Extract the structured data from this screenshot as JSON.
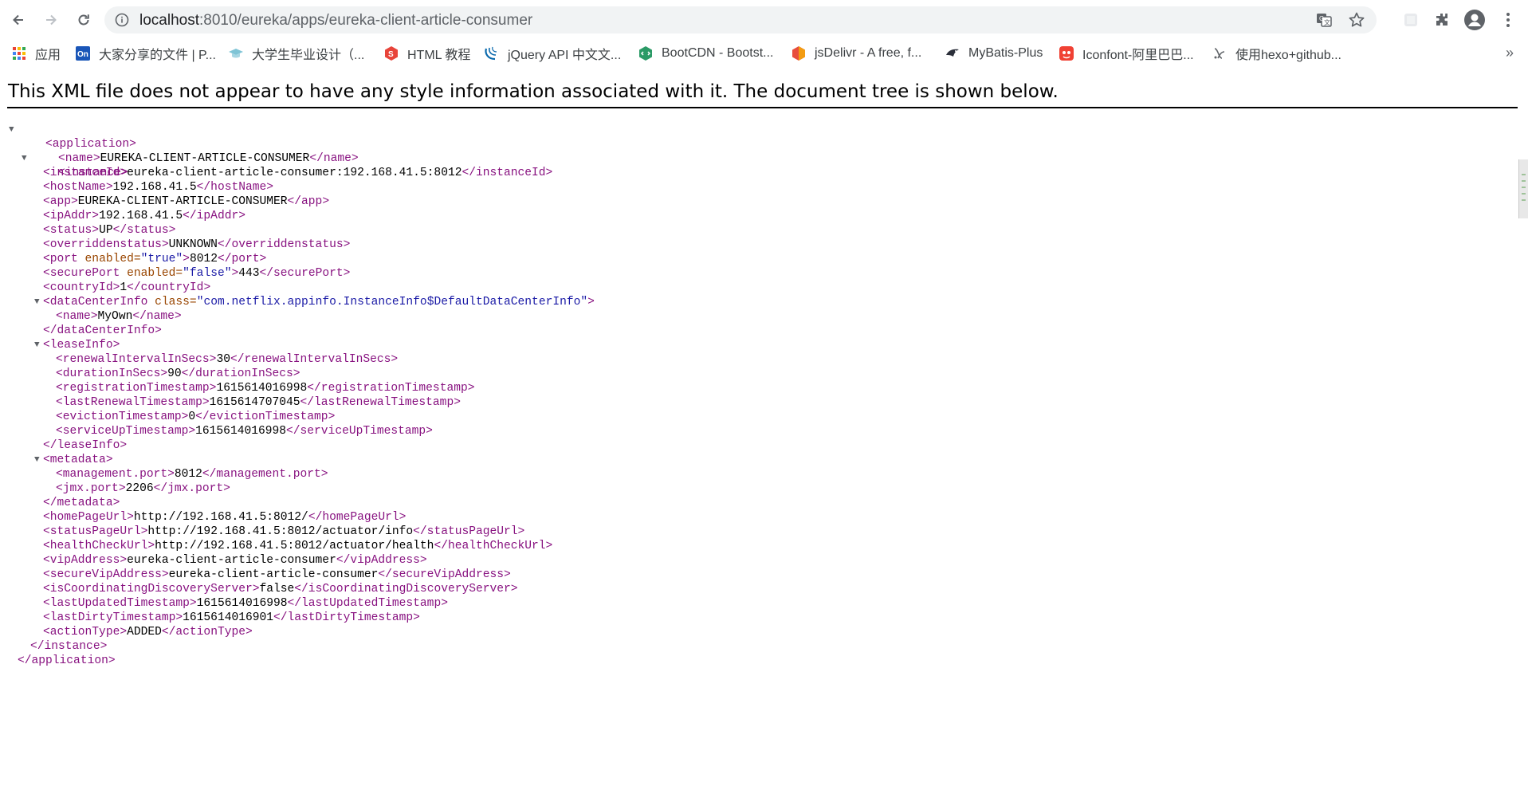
{
  "browser": {
    "url_host": "localhost",
    "url_rest": ":8010/eureka/apps/eureka-client-article-consumer"
  },
  "bookmarks": [
    {
      "label": "应用",
      "icon": "apps-grid-icon"
    },
    {
      "label": "大家分享的文件 | P...",
      "icon": "on-logo-icon"
    },
    {
      "label": "大学生毕业设计（...",
      "icon": "mortarboard-icon"
    },
    {
      "label": "HTML 教程",
      "icon": "runoob-icon"
    },
    {
      "label": "jQuery API 中文文...",
      "icon": "jquery-icon"
    },
    {
      "label": "BootCDN - Bootst...",
      "icon": "bootcdn-icon"
    },
    {
      "label": "jsDelivr - A free, f...",
      "icon": "jsdelivr-icon"
    },
    {
      "label": "MyBatis-Plus",
      "icon": "mybatis-plus-icon"
    },
    {
      "label": "Iconfont-阿里巴巴...",
      "icon": "iconfont-icon"
    },
    {
      "label": "使用hexo+github...",
      "icon": "hexo-icon"
    }
  ],
  "bookmarks_more": "»",
  "notice": "This XML file does not appear to have any style information associated with it. The document tree is shown below.",
  "colors": {
    "tag": "#881280",
    "attribute_name": "#994500",
    "attribute_value": "#1a1aa6",
    "text": "#000000"
  },
  "xml": {
    "application_open": "<application>",
    "name": {
      "open": "<name>",
      "value": "EUREKA-CLIENT-ARTICLE-CONSUMER",
      "close": "</name>"
    },
    "instance_open": "<instance>",
    "fields": [
      {
        "open": "<instanceId>",
        "value": "eureka-client-article-consumer:192.168.41.5:8012",
        "close": "</instanceId>"
      },
      {
        "open": "<hostName>",
        "value": "192.168.41.5",
        "close": "</hostName>"
      },
      {
        "open": "<app>",
        "value": "EUREKA-CLIENT-ARTICLE-CONSUMER",
        "close": "</app>"
      },
      {
        "open": "<ipAddr>",
        "value": "192.168.41.5",
        "close": "</ipAddr>"
      },
      {
        "open": "<status>",
        "value": "UP",
        "close": "</status>"
      },
      {
        "open": "<overriddenstatus>",
        "value": "UNKNOWN",
        "close": "</overriddenstatus>"
      }
    ],
    "port": {
      "open_start": "<port",
      "attr": " enabled=",
      "attr_value": "\"true\"",
      "open_end": ">",
      "value": "8012",
      "close": "</port>"
    },
    "securePort": {
      "open_start": "<securePort",
      "attr": " enabled=",
      "attr_value": "\"false\"",
      "open_end": ">",
      "value": "443",
      "close": "</securePort>"
    },
    "countryId": {
      "open": "<countryId>",
      "value": "1",
      "close": "</countryId>"
    },
    "dataCenterInfo": {
      "open_start": "<dataCenterInfo",
      "attr": " class=",
      "attr_value": "\"com.netflix.appinfo.InstanceInfo$DefaultDataCenterInfo\"",
      "open_end": ">",
      "name": {
        "open": "<name>",
        "value": "MyOwn",
        "close": "</name>"
      },
      "close": "</dataCenterInfo>"
    },
    "leaseInfo": {
      "open": "<leaseInfo>",
      "fields": [
        {
          "open": "<renewalIntervalInSecs>",
          "value": "30",
          "close": "</renewalIntervalInSecs>"
        },
        {
          "open": "<durationInSecs>",
          "value": "90",
          "close": "</durationInSecs>"
        },
        {
          "open": "<registrationTimestamp>",
          "value": "1615614016998",
          "close": "</registrationTimestamp>"
        },
        {
          "open": "<lastRenewalTimestamp>",
          "value": "1615614707045",
          "close": "</lastRenewalTimestamp>"
        },
        {
          "open": "<evictionTimestamp>",
          "value": "0",
          "close": "</evictionTimestamp>"
        },
        {
          "open": "<serviceUpTimestamp>",
          "value": "1615614016998",
          "close": "</serviceUpTimestamp>"
        }
      ],
      "close": "</leaseInfo>"
    },
    "metadata": {
      "open": "<metadata>",
      "fields": [
        {
          "open": "<management.port>",
          "value": "8012",
          "close": "</management.port>"
        },
        {
          "open": "<jmx.port>",
          "value": "2206",
          "close": "</jmx.port>"
        }
      ],
      "close": "</metadata>"
    },
    "tail_fields": [
      {
        "open": "<homePageUrl>",
        "value": "http://192.168.41.5:8012/",
        "close": "</homePageUrl>"
      },
      {
        "open": "<statusPageUrl>",
        "value": "http://192.168.41.5:8012/actuator/info",
        "close": "</statusPageUrl>"
      },
      {
        "open": "<healthCheckUrl>",
        "value": "http://192.168.41.5:8012/actuator/health",
        "close": "</healthCheckUrl>"
      },
      {
        "open": "<vipAddress>",
        "value": "eureka-client-article-consumer",
        "close": "</vipAddress>"
      },
      {
        "open": "<secureVipAddress>",
        "value": "eureka-client-article-consumer",
        "close": "</secureVipAddress>"
      },
      {
        "open": "<isCoordinatingDiscoveryServer>",
        "value": "false",
        "close": "</isCoordinatingDiscoveryServer>"
      },
      {
        "open": "<lastUpdatedTimestamp>",
        "value": "1615614016998",
        "close": "</lastUpdatedTimestamp>"
      },
      {
        "open": "<lastDirtyTimestamp>",
        "value": "1615614016901",
        "close": "</lastDirtyTimestamp>"
      },
      {
        "open": "<actionType>",
        "value": "ADDED",
        "close": "</actionType>"
      }
    ],
    "instance_close": "</instance>",
    "application_close": "</application>",
    "toggle_glyph": "▼"
  }
}
